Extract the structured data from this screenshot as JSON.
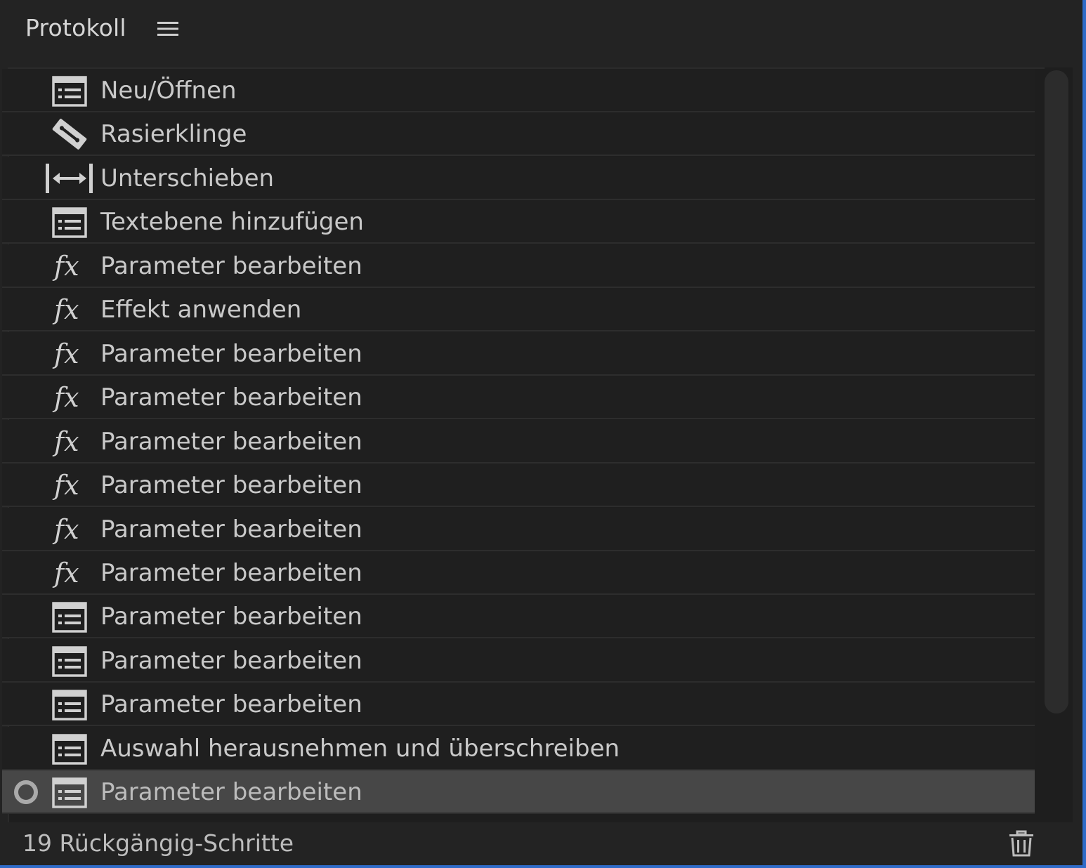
{
  "header": {
    "title": "Protokoll",
    "menu_icon": "hamburger-menu-icon"
  },
  "history": {
    "items": [
      {
        "icon": "list-document-icon",
        "label": "Neu/Öffnen"
      },
      {
        "icon": "razor-blade-icon",
        "label": "Rasierklinge"
      },
      {
        "icon": "slip-arrows-icon",
        "label": "Unterschieben"
      },
      {
        "icon": "list-document-icon",
        "label": "Textebene hinzufügen"
      },
      {
        "icon": "fx-icon",
        "label": "Parameter bearbeiten"
      },
      {
        "icon": "fx-icon",
        "label": "Effekt anwenden"
      },
      {
        "icon": "fx-icon",
        "label": "Parameter bearbeiten"
      },
      {
        "icon": "fx-icon",
        "label": "Parameter bearbeiten"
      },
      {
        "icon": "fx-icon",
        "label": "Parameter bearbeiten"
      },
      {
        "icon": "fx-icon",
        "label": "Parameter bearbeiten"
      },
      {
        "icon": "fx-icon",
        "label": "Parameter bearbeiten"
      },
      {
        "icon": "fx-icon",
        "label": "Parameter bearbeiten"
      },
      {
        "icon": "list-document-icon",
        "label": "Parameter bearbeiten"
      },
      {
        "icon": "list-document-icon",
        "label": "Parameter bearbeiten"
      },
      {
        "icon": "list-document-icon",
        "label": "Parameter bearbeiten"
      },
      {
        "icon": "list-document-icon",
        "label": "Auswahl herausnehmen und überschreiben"
      },
      {
        "icon": "list-document-icon",
        "label": "Parameter bearbeiten",
        "selected": true
      }
    ]
  },
  "footer": {
    "undo_steps": "19 Rückgängig-Schritte",
    "delete_icon": "trash-icon"
  },
  "colors": {
    "panel_bg": "#232323",
    "row_bg": "#1f1f1f",
    "selected_row_bg": "#474747",
    "text": "#c9c9c9",
    "focus_border": "#2f6bc8"
  }
}
